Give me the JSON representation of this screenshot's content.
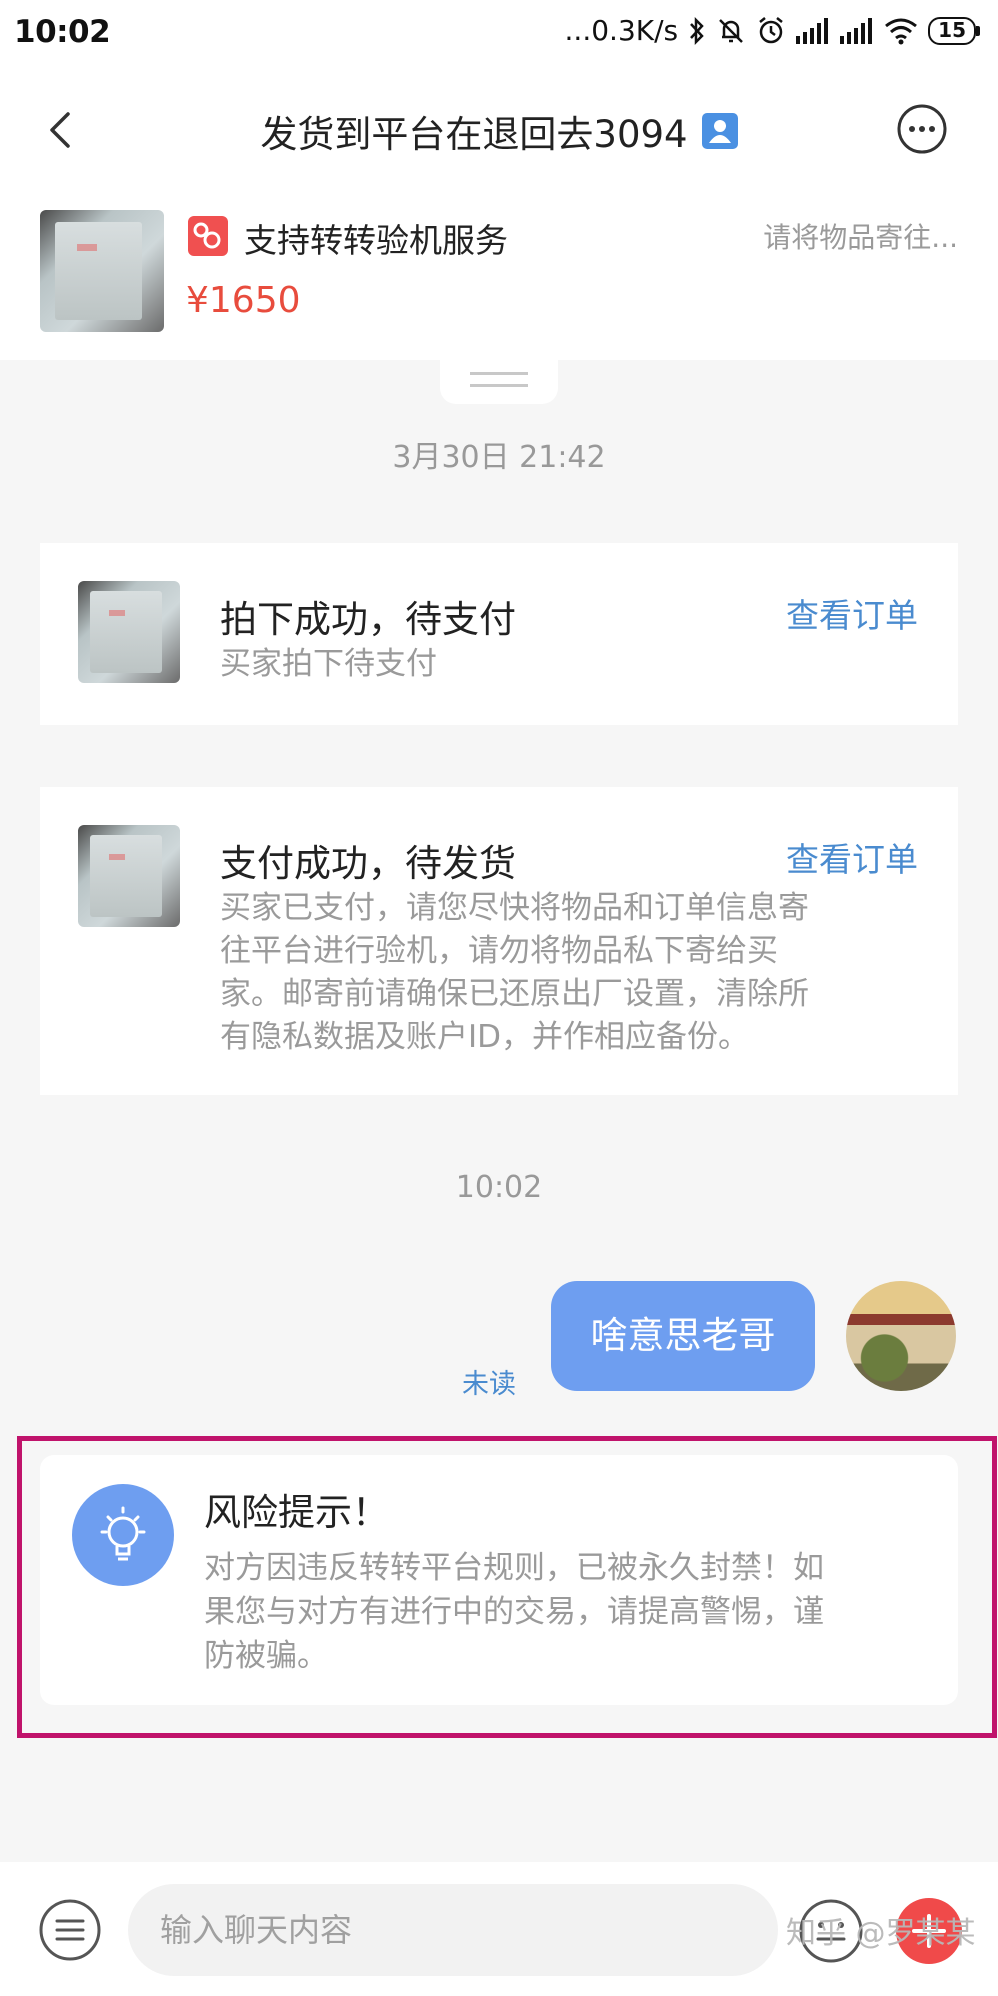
{
  "status_bar": {
    "time": "10:02",
    "net_speed": "...0.3K/s",
    "battery": "15",
    "icons": [
      "bluetooth-icon",
      "mute-icon",
      "alarm-icon",
      "signal-icon",
      "signal-icon",
      "wifi-icon",
      "battery-icon"
    ]
  },
  "header": {
    "title": "发货到平台在退回去3094",
    "back_icon": "back-arrow-icon",
    "more_icon": "more-icon"
  },
  "product": {
    "service_label": "支持转转验机服务",
    "price": "¥1650",
    "ship_note": "请将物品寄往..."
  },
  "timeline": [
    {
      "timestamp": "3月30日 21:42"
    },
    {
      "timestamp": "10:02"
    }
  ],
  "cards": [
    {
      "title": "拍下成功，待支付",
      "subtitle": "买家拍下待支付",
      "link": "查看订单"
    },
    {
      "title": "支付成功，待发货",
      "lines": [
        "买家已支付，请您尽快将物品和订单信息寄",
        "往平台进行验机，请勿将物品私下寄给买",
        "家。邮寄前请确保已还原出厂设置，清除所",
        "有隐私数据及账户ID，并作相应备份。"
      ],
      "link": "查看订单"
    }
  ],
  "message": {
    "text": "啥意思老哥",
    "status": "未读"
  },
  "risk": {
    "title": "风险提示！",
    "lines": [
      "对方因违反转转平台规则，已被永久封禁！如",
      "果您与对方有进行中的交易，请提高警惕，谨",
      "防被骗。"
    ]
  },
  "input_bar": {
    "placeholder": "输入聊天内容"
  },
  "watermark": "知乎 @罗某某",
  "colors": {
    "accent_blue": "#6e9ef0",
    "link_blue": "#4a8bcf",
    "price_red": "#e84c3d",
    "highlight_frame": "#c0136b"
  }
}
